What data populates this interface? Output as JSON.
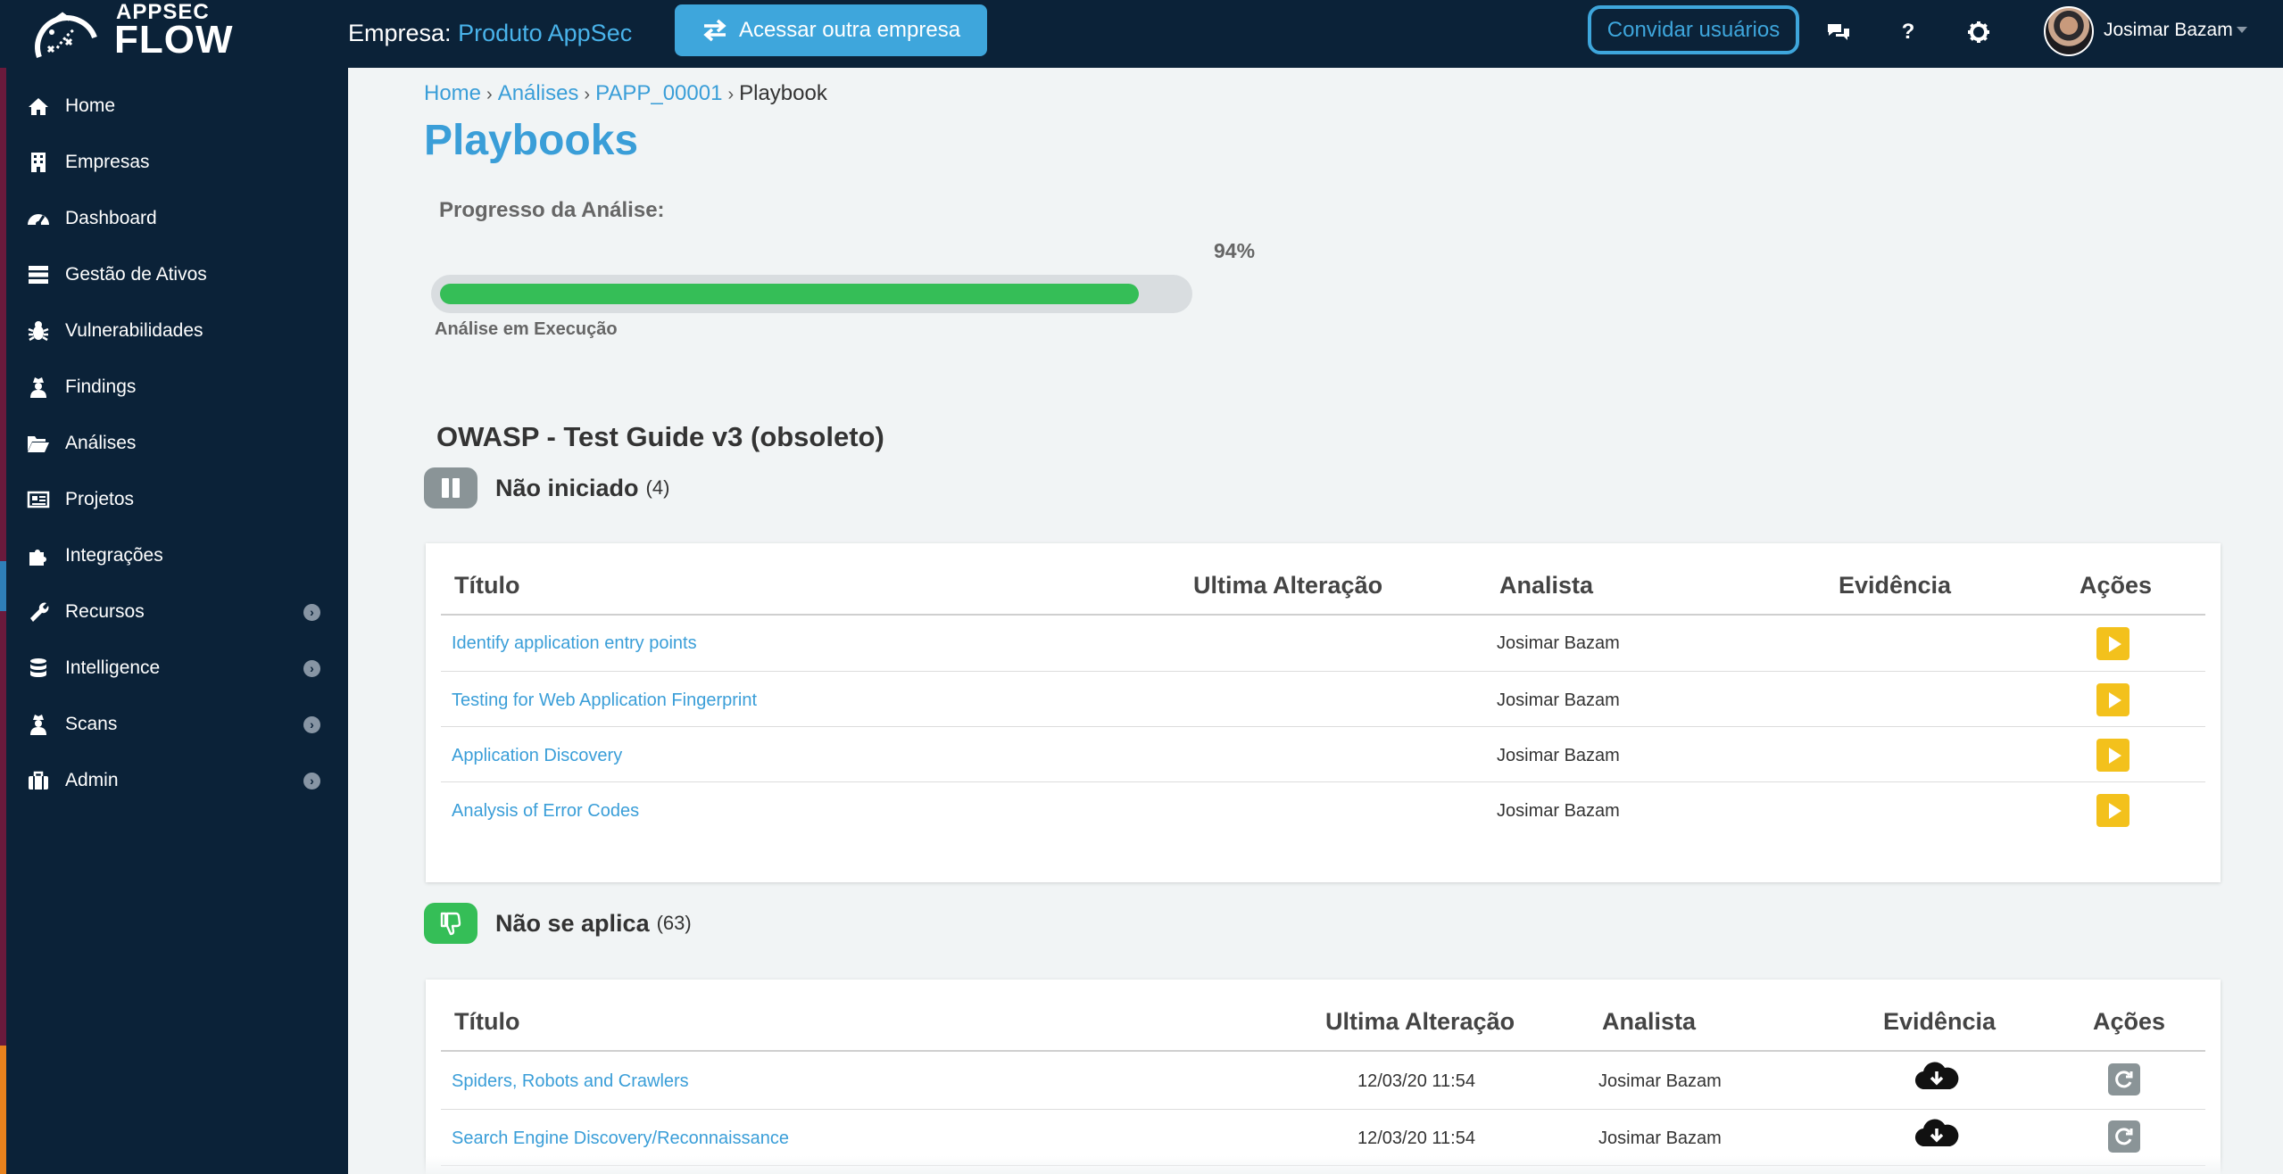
{
  "brand": {
    "top": "APPSEC",
    "bottom": "FLOW"
  },
  "header": {
    "company_prefix": "Empresa:",
    "company_name": "Produto AppSec",
    "switch_button": "Acessar outra empresa",
    "invite_button": "Convidar usuários",
    "help_glyph": "?",
    "user_name": "Josimar Bazam",
    "icons": [
      "chat-icon",
      "help-icon",
      "gear-icon",
      "avatar",
      "caret-down-icon"
    ]
  },
  "sidebar": {
    "items": [
      {
        "label": "Home",
        "icon": "home-icon"
      },
      {
        "label": "Empresas",
        "icon": "building-icon"
      },
      {
        "label": "Dashboard",
        "icon": "dashboard-icon"
      },
      {
        "label": "Gestão de Ativos",
        "icon": "server-icon"
      },
      {
        "label": "Vulnerabilidades",
        "icon": "bug-icon"
      },
      {
        "label": "Findings",
        "icon": "user-secret-icon"
      },
      {
        "label": "Análises",
        "icon": "folder-open-icon"
      },
      {
        "label": "Projetos",
        "icon": "newspaper-icon"
      },
      {
        "label": "Integrações",
        "icon": "puzzle-icon"
      },
      {
        "label": "Recursos",
        "icon": "wrench-icon",
        "expandable": true
      },
      {
        "label": "Intelligence",
        "icon": "database-icon",
        "expandable": true
      },
      {
        "label": "Scans",
        "icon": "user-secret-icon",
        "expandable": true
      },
      {
        "label": "Admin",
        "icon": "briefcase-icon",
        "expandable": true
      }
    ],
    "expand_glyph": "›"
  },
  "breadcrumb": {
    "items": [
      "Home",
      "Análises",
      "PAPP_00001",
      "Playbook"
    ],
    "separator": "›"
  },
  "page": {
    "title": "Playbooks",
    "progress_label": "Progresso da Análise:",
    "progress_percent_text": "94%",
    "progress_value": 0.94,
    "progress_status": "Análise em Execução",
    "guide_title": "OWASP - Test Guide v3 (obsoleto)"
  },
  "sections": [
    {
      "name": "Não iniciado",
      "count": "(4)",
      "icon": "pause-icon",
      "color": "#8a9497",
      "columns": [
        "Título",
        "Ultima Alteração",
        "Analista",
        "Evidência",
        "Ações"
      ],
      "rows": [
        {
          "title": "Identify application entry points",
          "date": "",
          "analyst": "Josimar Bazam",
          "action": "play"
        },
        {
          "title": "Testing for Web Application Fingerprint",
          "date": "",
          "analyst": "Josimar Bazam",
          "action": "play"
        },
        {
          "title": "Application Discovery",
          "date": "",
          "analyst": "Josimar Bazam",
          "action": "play"
        },
        {
          "title": "Analysis of Error Codes",
          "date": "",
          "analyst": "Josimar Bazam",
          "action": "play"
        }
      ]
    },
    {
      "name": "Não se aplica",
      "count": "(63)",
      "icon": "thumbs-down-icon",
      "color": "#35be57",
      "columns": [
        "Título",
        "Ultima Alteração",
        "Analista",
        "Evidência",
        "Ações"
      ],
      "rows": [
        {
          "title": "Spiders, Robots and Crawlers",
          "date": "12/03/20 11:54",
          "analyst": "Josimar Bazam",
          "evidence": "cloud-download-icon",
          "action": "redo"
        },
        {
          "title": "Search Engine Discovery/Reconnaissance",
          "date": "12/03/20 11:54",
          "analyst": "Josimar Bazam",
          "evidence": "cloud-download-icon",
          "action": "redo"
        }
      ]
    }
  ],
  "colors": {
    "navy": "#0b2238",
    "accent_blue": "#3a9ed8",
    "progress_green": "#35be57",
    "play_yellow": "#f3c11c",
    "grey_button": "#8a9497"
  }
}
